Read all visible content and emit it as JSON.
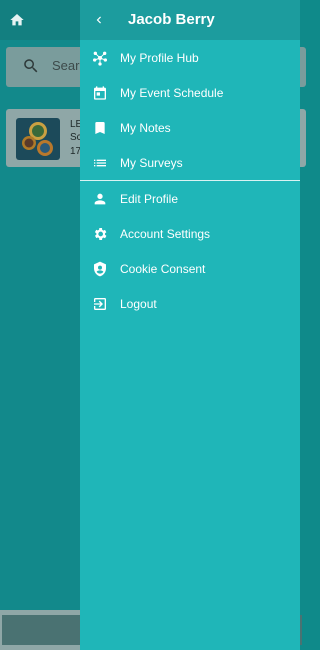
{
  "app": {
    "search_placeholder": "Search",
    "session_card": {
      "line1": "LE",
      "line2": "Sc",
      "line3": "17"
    }
  },
  "drawer": {
    "title": "Jacob Berry",
    "primary_items": [
      {
        "label": "My Profile Hub",
        "icon": "hub-icon"
      },
      {
        "label": "My Event Schedule",
        "icon": "calendar-icon"
      },
      {
        "label": "My Notes",
        "icon": "bookmark-icon"
      },
      {
        "label": "My Surveys",
        "icon": "list-icon"
      }
    ],
    "secondary_items": [
      {
        "label": "Edit Profile",
        "icon": "person-icon"
      },
      {
        "label": "Account Settings",
        "icon": "gear-icon"
      },
      {
        "label": "Cookie Consent",
        "icon": "shield-icon"
      },
      {
        "label": "Logout",
        "icon": "logout-icon"
      }
    ]
  },
  "colors": {
    "drawer_bg": "#1fb6b8",
    "drawer_header_bg": "#1c9c9e",
    "background_app": "#12898b"
  }
}
